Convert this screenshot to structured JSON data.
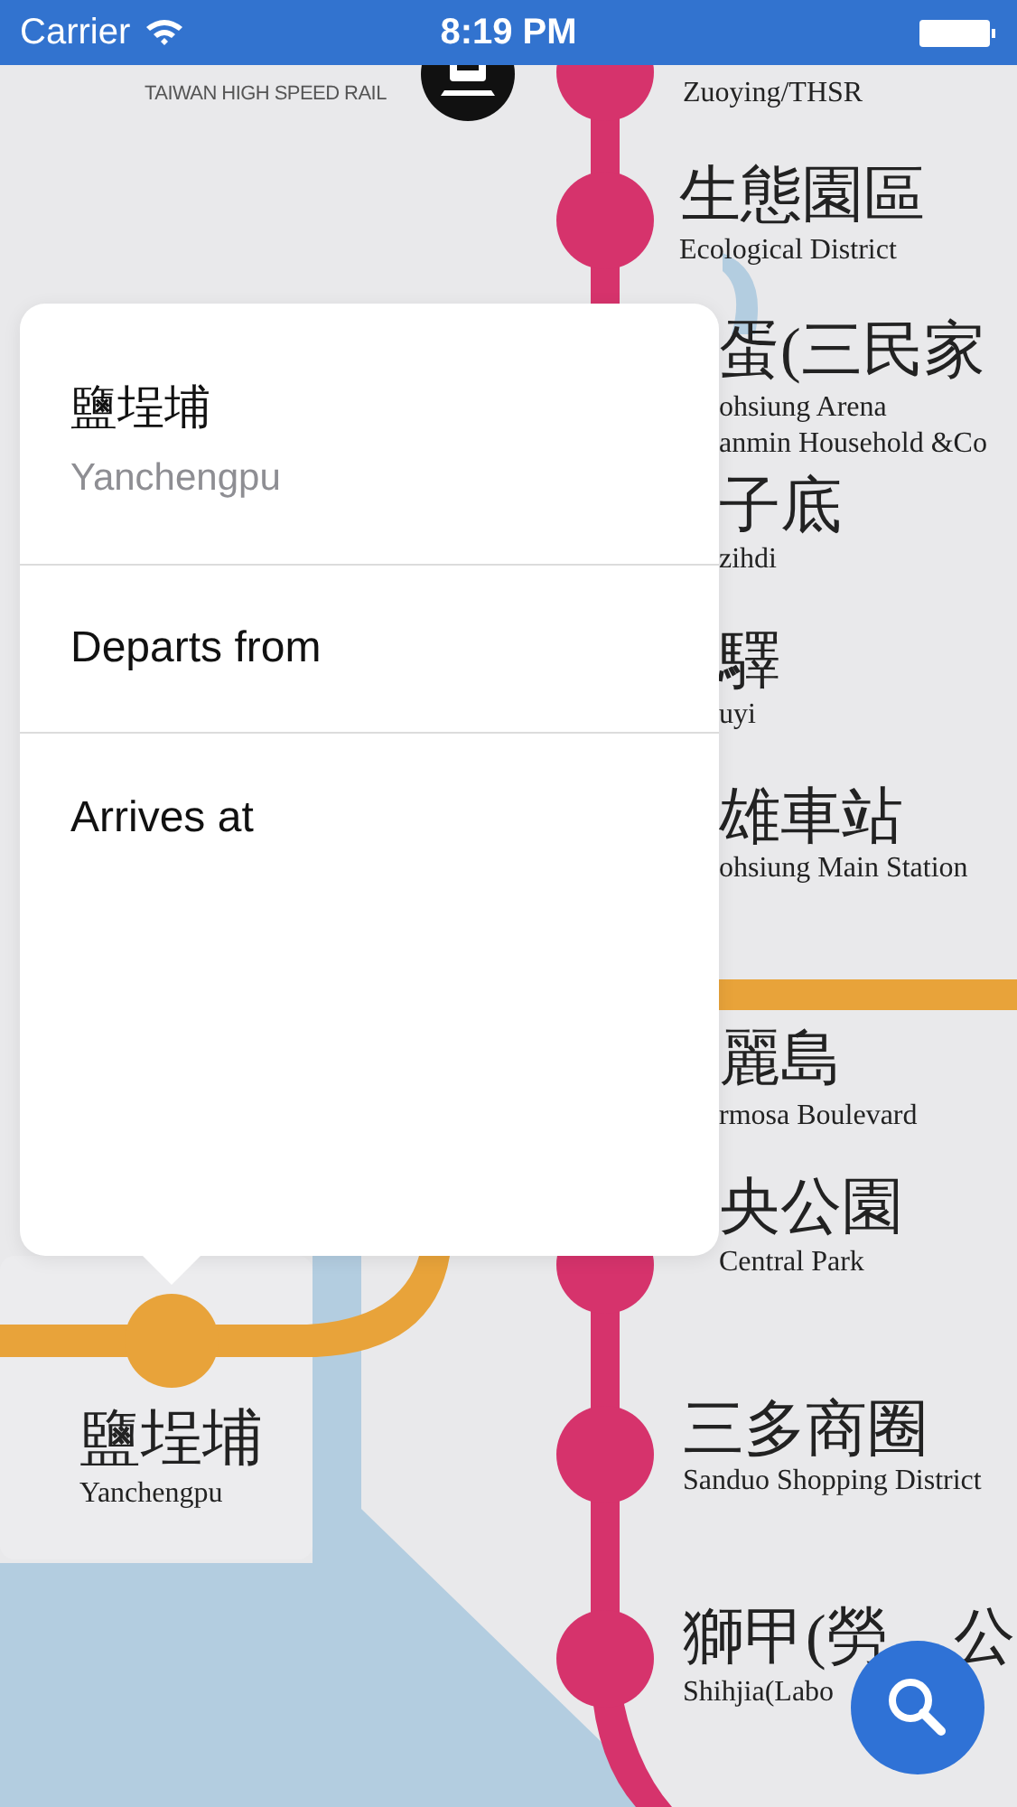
{
  "status_bar": {
    "carrier": "Carrier",
    "time": "8:19 PM"
  },
  "map": {
    "logo_text": "TAIWAN HIGH SPEED RAIL",
    "stations": [
      {
        "subtitle": "Zuoying/THSR"
      },
      {
        "name": "生態園區",
        "subtitle": "Ecological District"
      },
      {
        "name": "蛋(三民家",
        "subtitle": "ohsiung Arena",
        "subtitle_2": "anmin Household &Co"
      },
      {
        "name": "子底",
        "subtitle": "zihdi"
      },
      {
        "name": "驛",
        "subtitle": "uyi"
      },
      {
        "name": "雄車站",
        "subtitle": "ohsiung Main Station"
      },
      {
        "name": "麗島",
        "subtitle": "rmosa Boulevard"
      },
      {
        "name": "央公園",
        "subtitle": "Central Park"
      },
      {
        "name": "三多商圈",
        "subtitle": "Sanduo Shopping District"
      },
      {
        "name": "獅甲(勞",
        "name_2": "公",
        "subtitle": "Shihjia(Labo"
      },
      {
        "name": "鹽埕埔",
        "subtitle": "Yanchengpu"
      }
    ]
  },
  "popover": {
    "title": "鹽埕埔",
    "subtitle": "Yanchengpu",
    "options": [
      "Departs from",
      "Arrives at"
    ]
  }
}
